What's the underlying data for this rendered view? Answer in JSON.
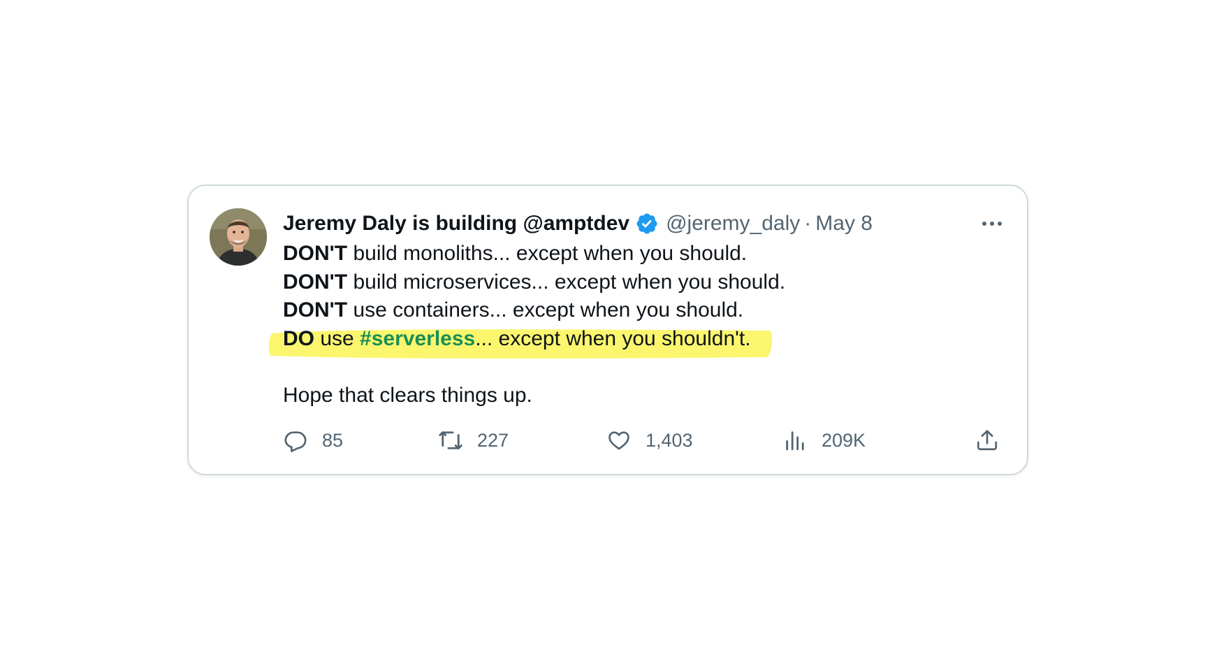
{
  "tweet": {
    "author": {
      "display_name": "Jeremy Daly is building @amptdev",
      "handle": "@jeremy_daly",
      "verified": true,
      "verified_color": "#1d9bf0"
    },
    "separator": "·",
    "date": "May 8",
    "lines": [
      {
        "bold": "DON'T",
        "rest": " build monoliths... except when you should."
      },
      {
        "bold": "DON'T",
        "rest": " build microservices... except when you should."
      },
      {
        "bold": "DON'T",
        "rest": " use containers... except when you should."
      }
    ],
    "highlighted_line": {
      "bold": "DO",
      "pre": " use ",
      "hashtag": "#serverless",
      "rest": "... except when you shouldn't.",
      "highlight_color": "#fbf66e",
      "hashtag_color": "#1a8f55"
    },
    "closing": "Hope that clears things up.",
    "metrics": {
      "replies": "85",
      "retweets": "227",
      "likes": "1,403",
      "views": "209K"
    },
    "icons": {
      "more": "more-icon",
      "reply": "reply-icon",
      "retweet": "retweet-icon",
      "like": "heart-icon",
      "views": "views-icon",
      "share": "share-icon"
    }
  }
}
